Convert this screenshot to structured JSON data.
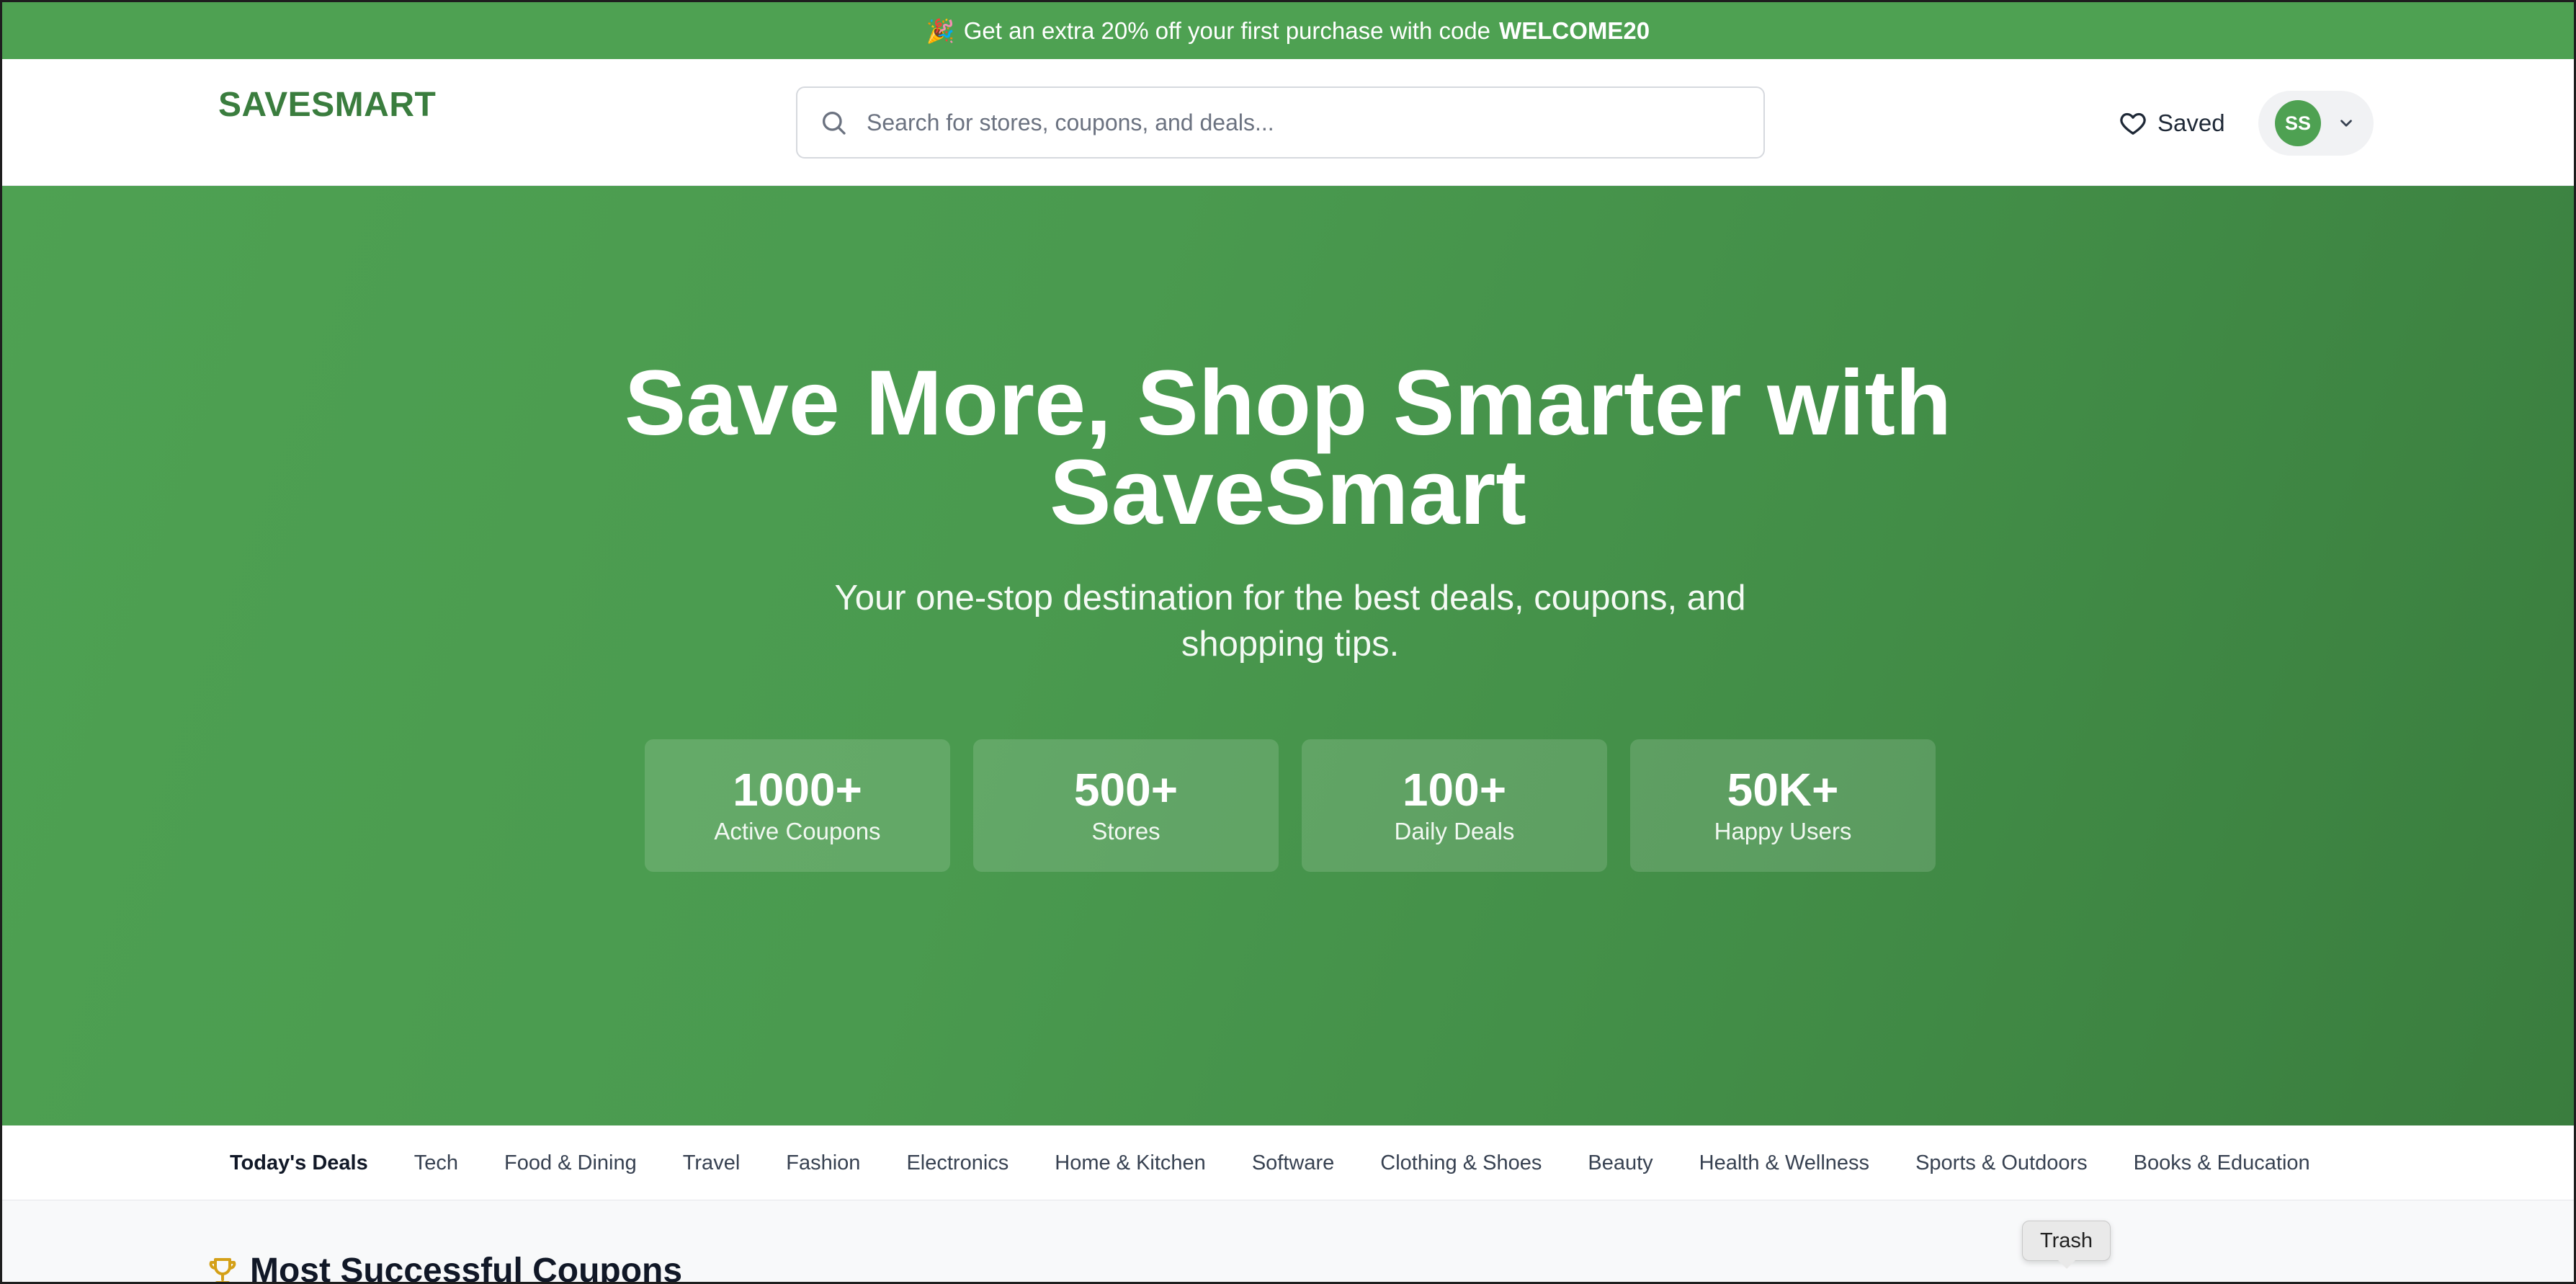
{
  "promo": {
    "text": "Get an extra 20% off your first purchase with code",
    "code": "WELCOME20"
  },
  "header": {
    "logo": "SAVESMART",
    "search_placeholder": "Search for stores, coupons, and deals...",
    "saved_label": "Saved",
    "avatar_initials": "SS"
  },
  "hero": {
    "title_line1": "Save More, Shop Smarter with",
    "title_line2": "SaveSmart",
    "subtitle": "Your one-stop destination for the best deals, coupons, and shopping tips.",
    "stats": [
      {
        "value": "1000+",
        "label": "Active Coupons"
      },
      {
        "value": "500+",
        "label": "Stores"
      },
      {
        "value": "100+",
        "label": "Daily Deals"
      },
      {
        "value": "50K+",
        "label": "Happy Users"
      }
    ]
  },
  "categories": {
    "items": [
      "Today's Deals",
      "Tech",
      "Food & Dining",
      "Travel",
      "Fashion",
      "Electronics",
      "Home & Kitchen",
      "Software",
      "Clothing & Shoes",
      "Beauty",
      "Health & Wellness",
      "Sports & Outdoors",
      "Books & Education"
    ],
    "active": "Today's Deals"
  },
  "section": {
    "title": "Most Successful Coupons"
  },
  "tooltip": {
    "text": "Trash"
  },
  "colors": {
    "brand_green": "#4ea152",
    "brand_dark_green": "#3a7d3e",
    "accent_gold": "#d4a017"
  },
  "icons": {
    "promo": "party-popper-icon",
    "search": "search-icon",
    "saved": "heart-icon",
    "user_menu": "chevron-down-icon",
    "section": "trophy-icon"
  }
}
